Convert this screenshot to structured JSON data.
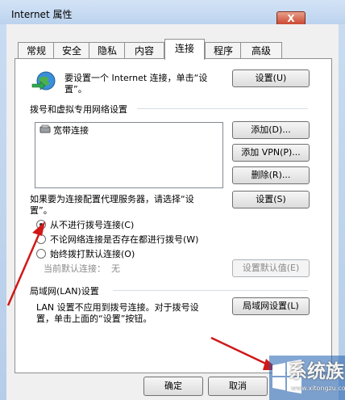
{
  "window": {
    "title": "Internet 属性",
    "close_glyph": "X"
  },
  "tabs": [
    {
      "label": "常规"
    },
    {
      "label": "安全"
    },
    {
      "label": "隐私"
    },
    {
      "label": "内容"
    },
    {
      "label": "连接"
    },
    {
      "label": "程序"
    },
    {
      "label": "高级"
    }
  ],
  "selected_tab": "连接",
  "setup": {
    "text_line1": "要设置一个 Internet 连接，单击“设",
    "text_line2": "置”。",
    "button": "设置(U)"
  },
  "dialup": {
    "group_label": "拨号和虚拟专用网络设置",
    "list_items": [
      {
        "label": "宽带连接"
      }
    ],
    "add_button": "添加(D)...",
    "add_vpn_button": "添加 VPN(P)...",
    "remove_button": "删除(R)...",
    "proxy_text_line1": "如果要为连接配置代理服务器，请选择“设",
    "proxy_text_line2": "置”。",
    "settings_button": "设置(S)",
    "options": [
      {
        "label": "从不进行拨号连接(C)",
        "checked": true
      },
      {
        "label": "不论网络连接是否存在都进行拨号(W)",
        "checked": false
      },
      {
        "label": "始终拨打默认连接(O)",
        "checked": false
      }
    ],
    "current_default_label": "当前默认连接：",
    "current_default_value": "无",
    "set_default_button": "设置默认值(E)"
  },
  "lan": {
    "group_label": "局域网(LAN)设置",
    "text_line1": "LAN 设置不应用到拨号连接。对于拨号设",
    "text_line2": "置，单击上面的“设置”按钮。",
    "button": "局域网设置(L)"
  },
  "footer": {
    "ok_button": "确定",
    "cancel_button": "取消"
  },
  "watermark": {
    "text": "系统族",
    "url": "www.xitongzu.com"
  },
  "colors": {
    "annotation_arrow": "#d01818",
    "title_gradient": "#c9dcf2"
  }
}
